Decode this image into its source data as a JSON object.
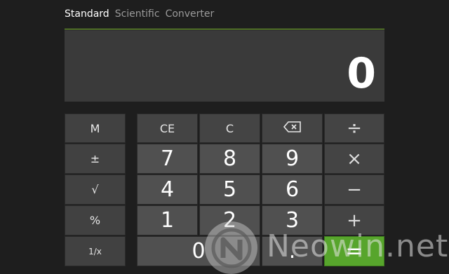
{
  "tabs": [
    "Standard",
    "Scientific",
    "Converter"
  ],
  "display": {
    "value": "0"
  },
  "buttons": {
    "m": "M",
    "plus_minus": "±",
    "sqrt": "√",
    "percent": "%",
    "reciprocal": "1/x",
    "ce": "CE",
    "c": "C",
    "divide": "÷",
    "multiply": "×",
    "subtract": "−",
    "add": "+",
    "equals": "=",
    "d7": "7",
    "d8": "8",
    "d9": "9",
    "d4": "4",
    "d5": "5",
    "d6": "6",
    "d1": "1",
    "d2": "2",
    "d3": "3",
    "d0": "0",
    "decimal": "."
  },
  "watermark": {
    "text": "Neowin.net"
  },
  "colors": {
    "background": "#1e1e1e",
    "accent": "#7cb82f",
    "equals": "#57a52c",
    "display": "#3a3a3a"
  },
  "icons": {
    "backspace": "backspace-icon",
    "watermark_logo": "neowin-logo-icon"
  }
}
